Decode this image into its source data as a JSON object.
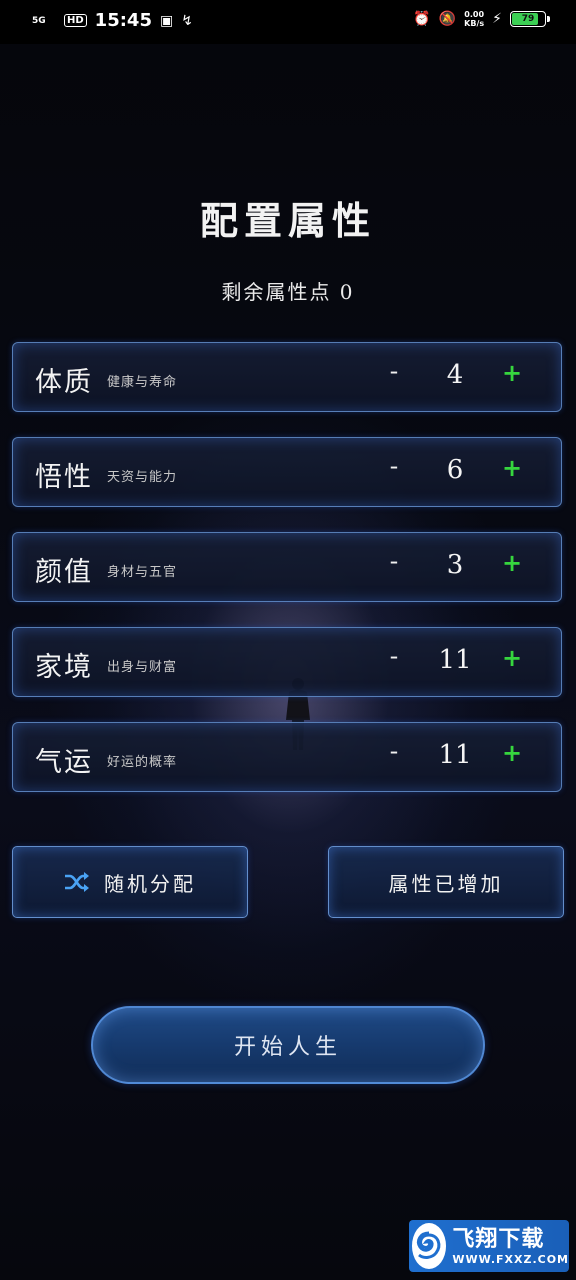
{
  "status_bar": {
    "signal": "5G",
    "hd": "HD",
    "time": "15:45",
    "speed_value": "0.00",
    "speed_unit": "KB/s",
    "battery": "79"
  },
  "page": {
    "title": "配置属性",
    "remaining_label": "剩余属性点 0"
  },
  "attributes": [
    {
      "name": "体质",
      "desc": "健康与寿命",
      "value": "4",
      "minus": "-",
      "plus": "+"
    },
    {
      "name": "悟性",
      "desc": "天资与能力",
      "value": "6",
      "minus": "-",
      "plus": "+"
    },
    {
      "name": "颜值",
      "desc": "身材与五官",
      "value": "3",
      "minus": "-",
      "plus": "+"
    },
    {
      "name": "家境",
      "desc": "出身与财富",
      "value": "11",
      "minus": "-",
      "plus": "+"
    },
    {
      "name": "气运",
      "desc": "好运的概率",
      "value": "11",
      "minus": "-",
      "plus": "+"
    }
  ],
  "actions": {
    "random_label": "随机分配",
    "added_label": "属性已增加",
    "start_label": "开始人生"
  },
  "watermark": {
    "title": "飞翔下载",
    "url": "WWW.FXXZ.COM"
  },
  "colors": {
    "accent_border": "#6ea0e6",
    "plus_green": "#36d63e",
    "start_button": "#1f4a86"
  }
}
